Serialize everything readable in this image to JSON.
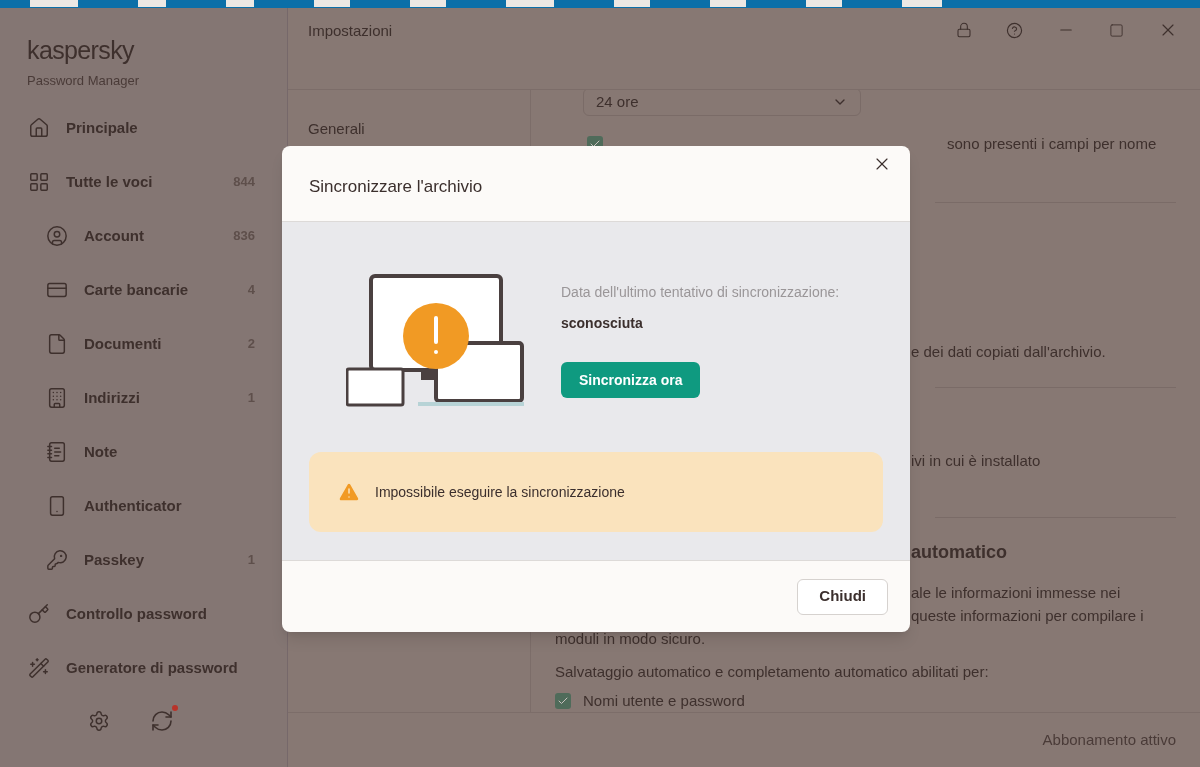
{
  "app": {
    "logo": "kaspersky",
    "product": "Password Manager"
  },
  "sidebar": {
    "items": [
      {
        "label": "Principale"
      },
      {
        "label": "Tutte le voci",
        "count": "844",
        "children": [
          {
            "label": "Account",
            "count": "836"
          },
          {
            "label": "Carte bancarie",
            "count": "4"
          },
          {
            "label": "Documenti",
            "count": "2"
          },
          {
            "label": "Indirizzi",
            "count": "1"
          },
          {
            "label": "Note"
          },
          {
            "label": "Authenticator"
          },
          {
            "label": "Passkey",
            "count": "1"
          }
        ]
      },
      {
        "label": "Controllo password"
      },
      {
        "label": "Generatore di password"
      }
    ],
    "sync_badge": true
  },
  "header": {
    "title": "Impostazioni"
  },
  "settings_nav": [
    {
      "label": "Generali"
    }
  ],
  "settings_content": {
    "dropdown": {
      "value": "24 ore"
    },
    "lines": [
      {
        "kind": "checkbox",
        "text": "sono presenti i campi per nome",
        "checked": true
      },
      {
        "kind": "divider"
      },
      {
        "kind": "text",
        "text": "e dei dati copiati dall'archivio."
      },
      {
        "kind": "divider"
      },
      {
        "kind": "text",
        "text": "ivi in cui è installato"
      },
      {
        "kind": "divider"
      },
      {
        "kind": "heading",
        "text": "automatico"
      },
      {
        "kind": "text",
        "text": "ale le informazioni immesse nei"
      },
      {
        "kind": "text",
        "text": "queste informazioni per compilare i"
      },
      {
        "kind": "full",
        "text": "moduli in modo sicuro."
      },
      {
        "kind": "full",
        "text": "Salvataggio automatico e completamento automatico abilitati per:"
      },
      {
        "kind": "fullcheckbox",
        "text": "Nomi utente e password",
        "checked": true
      }
    ]
  },
  "status_bar": {
    "text": "Abbonamento attivo"
  },
  "dialog": {
    "title": "Sincronizzare l'archivio",
    "label": "Data dell'ultimo tentativo di sincronizzazione:",
    "value": "sconosciuta",
    "action": "Sincronizza ora",
    "warning": "Impossibile eseguire la sincronizzazione",
    "close": "Chiudi"
  }
}
